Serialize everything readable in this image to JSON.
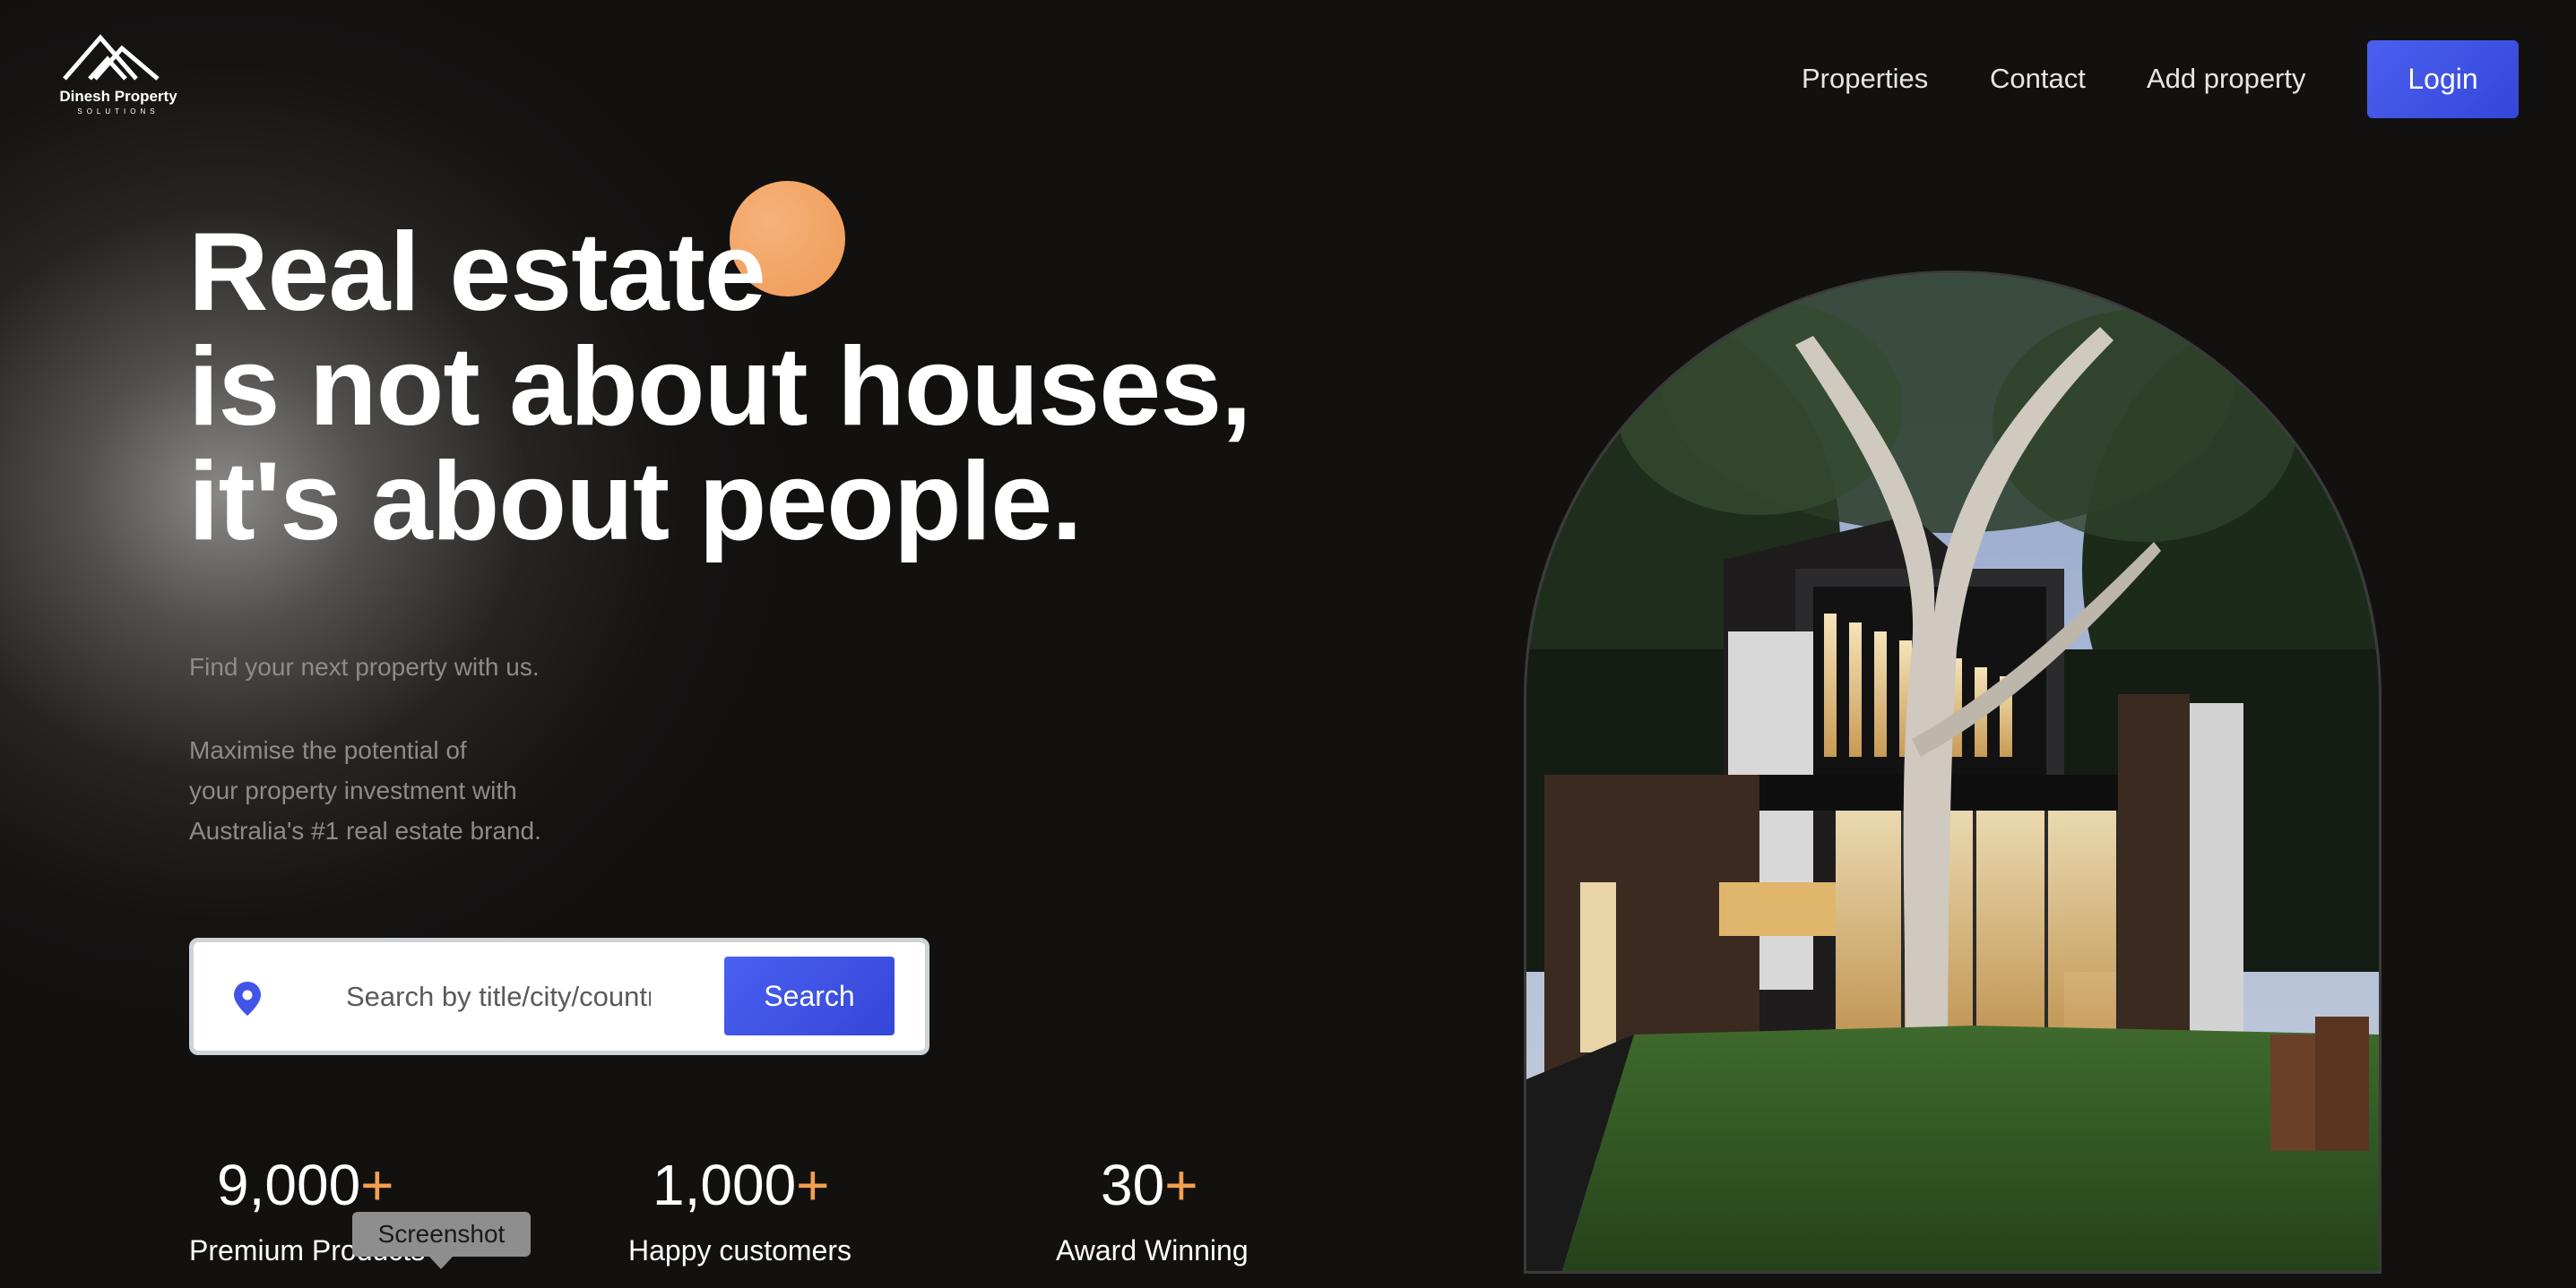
{
  "brand": {
    "name": "Dinesh Property",
    "tagline": "SOLUTIONS"
  },
  "nav": {
    "properties": "Properties",
    "contact": "Contact",
    "add_property": "Add property",
    "login": "Login"
  },
  "hero": {
    "headline_lines": [
      "Real estate",
      "is not about houses,",
      "it's about people."
    ],
    "subtitle": "Find your next property with us.",
    "description_lines": [
      "Maximise the potential of",
      "your property investment with",
      "Australia's #1 real estate brand."
    ]
  },
  "search": {
    "placeholder": "Search by title/city/country",
    "button_label": "Search",
    "icon": "location-pin-icon"
  },
  "stats": [
    {
      "number": "9,000",
      "suffix": "+",
      "label": "Premium Products"
    },
    {
      "number": "1,000",
      "suffix": "+",
      "label": "Happy customers"
    },
    {
      "number": "30",
      "suffix": "+",
      "label": "Award Winning"
    }
  ],
  "tooltip": {
    "text": "Screenshot"
  },
  "colors": {
    "background": "#131110",
    "accent_blue": "#4154e8",
    "accent_orange": "#f2a050",
    "muted_text": "#8e8c8a"
  }
}
